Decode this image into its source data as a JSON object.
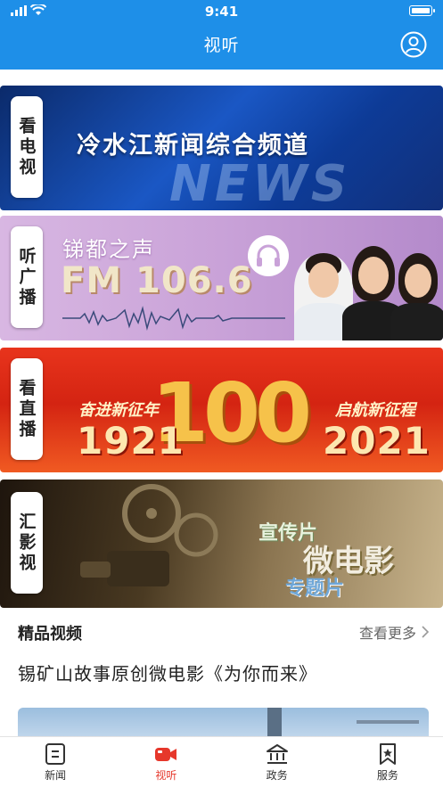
{
  "status_bar": {
    "time": "9:41"
  },
  "header": {
    "title": "视听",
    "user_icon": "user-circle-icon"
  },
  "banners": [
    {
      "label": "看电视",
      "title": "冷水江新闻综合频道",
      "overlay": "NEWS"
    },
    {
      "label": "听广播",
      "subtitle": "锑都之声",
      "frequency": "FM 106.6"
    },
    {
      "label": "看直播",
      "year_start": "1921",
      "year_end": "2021",
      "big_number": "100",
      "slogan_left": "奋进新征年",
      "slogan_right": "启航新征程"
    },
    {
      "label": "汇影视",
      "line1": "宣传片",
      "line2": "微电影",
      "line3": "专题片"
    }
  ],
  "section": {
    "title": "精品视频",
    "more": "查看更多",
    "video_title": "锡矿山故事原创微电影《为你而来》"
  },
  "tabbar": {
    "items": [
      {
        "label": "新闻",
        "icon": "news-icon"
      },
      {
        "label": "视听",
        "icon": "video-camera-icon"
      },
      {
        "label": "政务",
        "icon": "government-building-icon"
      },
      {
        "label": "服务",
        "icon": "bookmark-star-icon"
      }
    ],
    "active_index": 1
  },
  "colors": {
    "primary": "#1e8fe8",
    "active_tab": "#e6372b"
  }
}
